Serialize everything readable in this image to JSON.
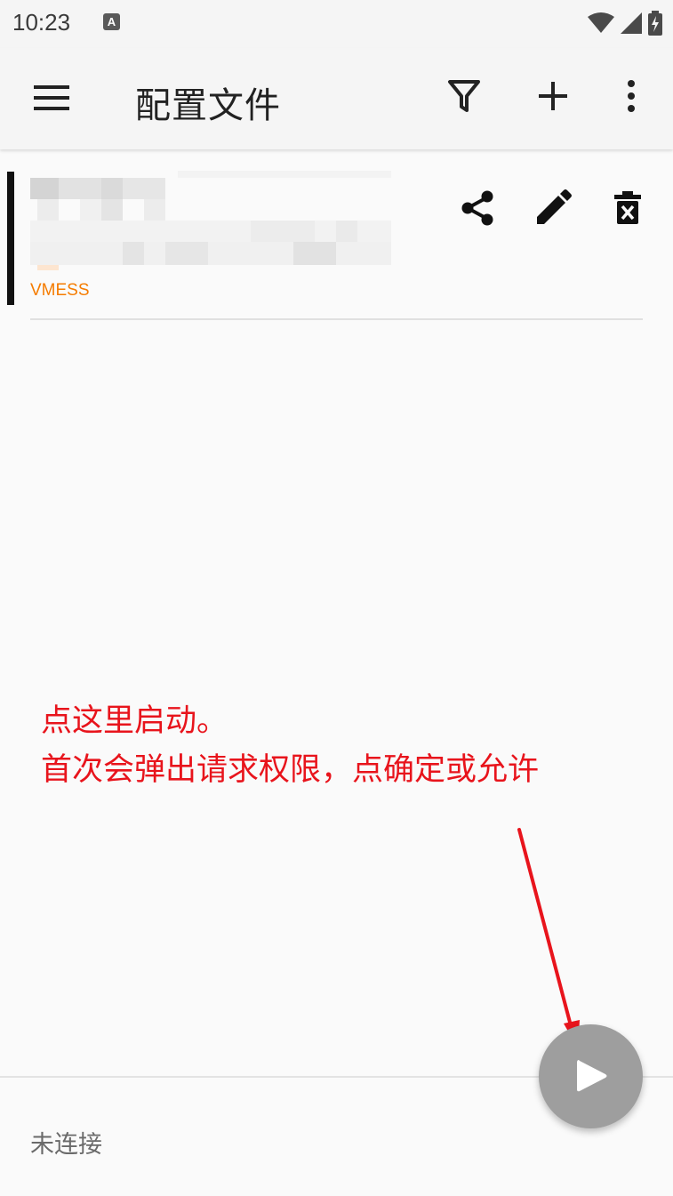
{
  "status_bar": {
    "time": "10:23",
    "notification_glyph": "A",
    "icons": [
      "wifi-icon",
      "signal-icon",
      "battery-charging-icon"
    ]
  },
  "app_bar": {
    "title": "配置文件",
    "actions": [
      "menu-icon",
      "filter-icon",
      "add-icon",
      "more-vert-icon"
    ]
  },
  "profile": {
    "type": "VMESS",
    "actions": [
      "share-icon",
      "edit-icon",
      "delete-icon"
    ],
    "selected": true
  },
  "annotation": {
    "line1": "点这里启动。",
    "line2": "首次会弹出请求权限，点确定或允许"
  },
  "bottom": {
    "connection_status": "未连接",
    "fab_icon": "play-icon"
  },
  "colors": {
    "accent_orange": "#f57c00",
    "annotation_red": "#e8141c",
    "fab_gray": "#9e9e9e"
  }
}
